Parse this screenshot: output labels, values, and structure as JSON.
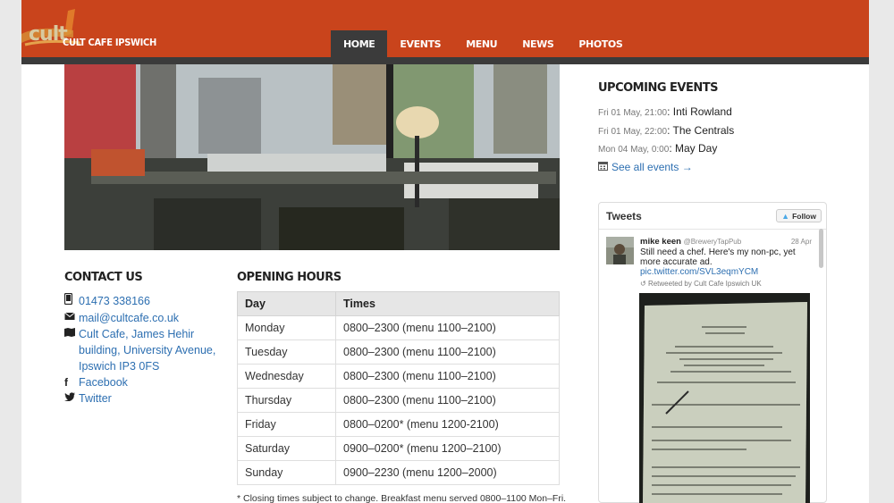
{
  "site": {
    "logo_word": "cult",
    "name": "CULT CAFE IPSWICH"
  },
  "nav": {
    "items": [
      "HOME",
      "EVENTS",
      "MENU",
      "NEWS",
      "PHOTOS"
    ],
    "active": "HOME"
  },
  "contact": {
    "title": "CONTACT US",
    "phone": "01473 338166",
    "email": "mail@cultcafe.co.uk",
    "address": "Cult Cafe, James Hehir building, University Avenue, Ipswich IP3 0FS",
    "facebook": "Facebook",
    "twitter": "Twitter"
  },
  "hours": {
    "title": "OPENING HOURS",
    "columns": [
      "Day",
      "Times"
    ],
    "rows": [
      [
        "Monday",
        "0800–2300 (menu 1100–2100)"
      ],
      [
        "Tuesday",
        "0800–2300 (menu 1100–2100)"
      ],
      [
        "Wednesday",
        "0800–2300 (menu 1100–2100)"
      ],
      [
        "Thursday",
        "0800–2300 (menu 1100–2100)"
      ],
      [
        "Friday",
        "0800–0200* (menu 1200-2100)"
      ],
      [
        "Saturday",
        "0900–0200* (menu 1200–2100)"
      ],
      [
        "Sunday",
        "0900–2230 (menu 1200–2000)"
      ]
    ],
    "note": "* Closing times subject to change. Breakfast menu served 0800–1100 Mon–Fri."
  },
  "events": {
    "title": "UPCOMING EVENTS",
    "items": [
      {
        "when": "Fri 01 May, 21:00",
        "what": "Inti Rowland"
      },
      {
        "when": "Fri 01 May, 22:00",
        "what": "The Centrals"
      },
      {
        "when": "Mon 04 May, 0:00",
        "what": "May Day"
      }
    ],
    "see_all": "See all events →"
  },
  "tweets": {
    "title": "Tweets",
    "follow_label": "Follow",
    "tweet": {
      "name": "mike keen",
      "handle": "@BreweryTapPub",
      "date": "28 Apr",
      "text": "Still need a chef. Here's my non-pc, yet more accurate ad.",
      "link": "pic.twitter.com/SVL3eqmYCM",
      "retweet": "Retweeted by Cult Cafe Ipswich UK"
    }
  },
  "colors": {
    "header": "#c9441c",
    "header_bar": "#3b3b3b",
    "link": "#2d6fb1"
  }
}
